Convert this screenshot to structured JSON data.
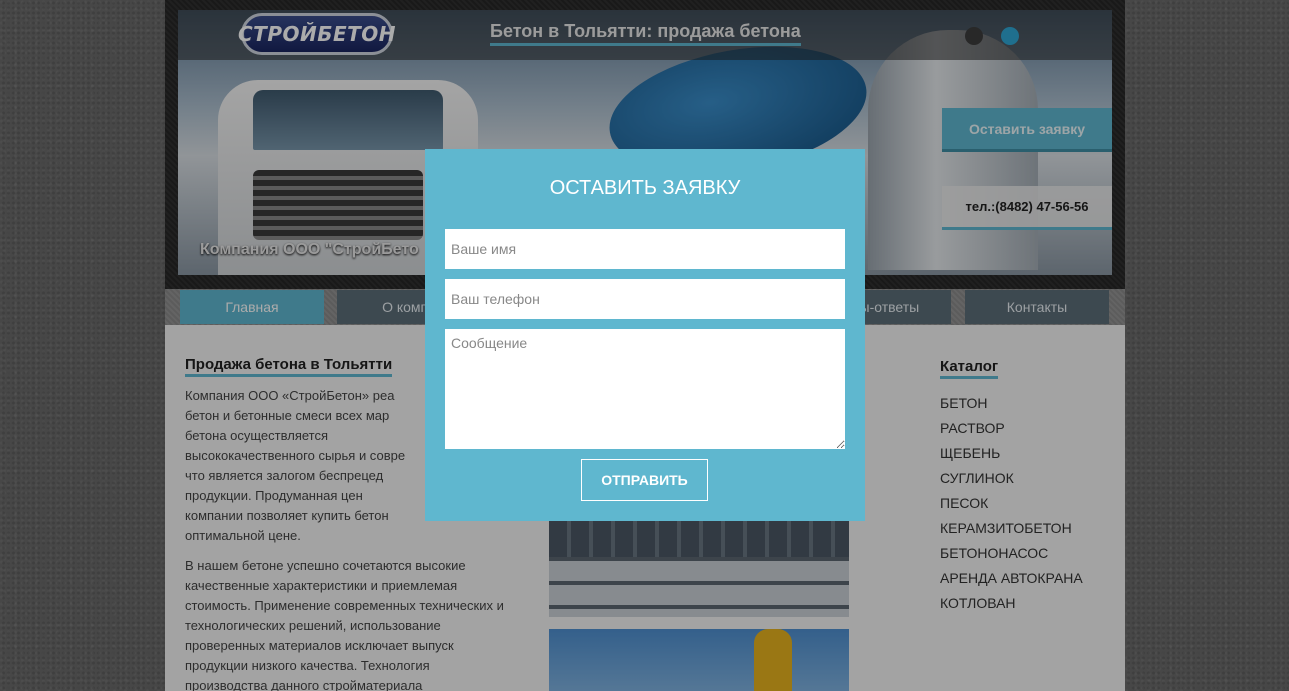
{
  "header": {
    "logo_text": "СТРОЙБЕТОН",
    "banner_title": "Бетон в Тольятти: продажа бетона",
    "cta_button": "Оставить заявку",
    "phone": "тел.:(8482) 47-56-56",
    "company_caption": "Компания ООО \"СтройБето",
    "accent_color": "#5fb7cf"
  },
  "nav": {
    "items": [
      {
        "label": "Главная"
      },
      {
        "label": "О компа"
      },
      {
        "label": "осы-ответы"
      },
      {
        "label": "Контакты"
      }
    ]
  },
  "content": {
    "title": "Продажа бетона в Тольятти",
    "para1_lines": [
      "Компания ООО «СтройБетон» реа",
      "бетон и бетонные смеси всех мар",
      "бетона осуществляется",
      "высококачественного сырья и совре",
      "что является залогом беспрецед",
      "продукции. Продуманная цен",
      "компании позволяет купить бетон",
      "оптимальной цене."
    ],
    "para2_lines": [
      "В нашем бетоне успешно сочетаются высокие",
      "качественные характеристики и приемлемая",
      "стоимость. Применение современных технических и",
      "технологических решений, использование",
      "проверенных материалов исключает выпуск",
      "продукции низкого качества. Технология",
      "производства данного стройматериала"
    ]
  },
  "catalog": {
    "title": "Каталог",
    "items": [
      "БЕТОН",
      "РАСТВОР",
      "ЩЕБЕНЬ",
      "СУГЛИНОК",
      "ПЕСОК",
      "КЕРАМЗИТОБЕТОН",
      "БЕТОНОНАСОС",
      "АРЕНДА АВТОКРАНА",
      "КОТЛОВАН"
    ]
  },
  "modal": {
    "title": "ОСТАВИТЬ ЗАЯВКУ",
    "name_placeholder": "Ваше имя",
    "phone_placeholder": "Ваш телефон",
    "message_placeholder": "Сообщение",
    "submit_label": "ОТПРАВИТЬ"
  }
}
